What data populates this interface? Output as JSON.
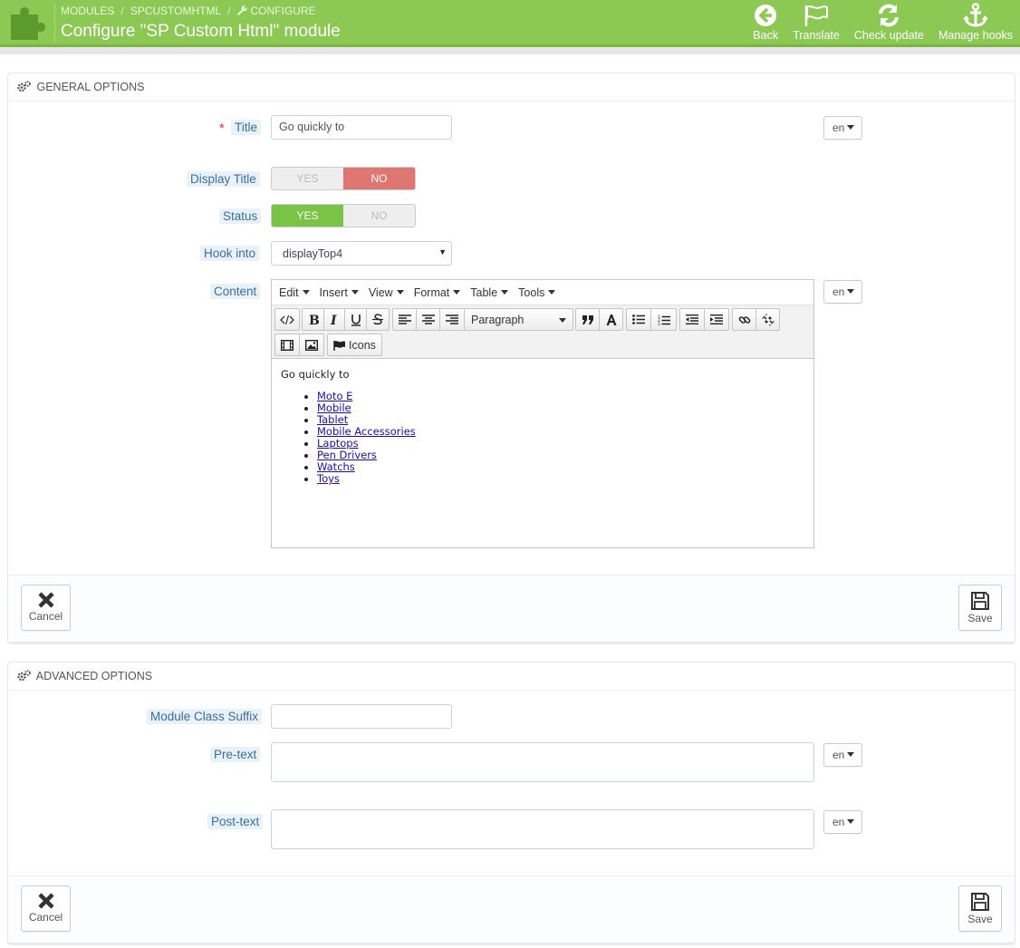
{
  "header": {
    "breadcrumb": [
      "MODULES",
      "SPCUSTOMHTML",
      "CONFIGURE"
    ],
    "breadcrumb_separator": "/",
    "title": "Configure \"SP Custom Html\" module",
    "toolbar": [
      {
        "label": "Back",
        "icon": "back-circle-arrow-icon"
      },
      {
        "label": "Translate",
        "icon": "flag-icon"
      },
      {
        "label": "Check update",
        "icon": "refresh-icon"
      },
      {
        "label": "Manage hooks",
        "icon": "anchor-icon"
      }
    ]
  },
  "general": {
    "heading": "GENERAL OPTIONS",
    "required_mark": "*",
    "title_label": "Title",
    "title_value": "Go quickly to",
    "lang": "en",
    "display_title_label": "Display Title",
    "display_title": {
      "yes": "YES",
      "no": "NO",
      "selected": "NO"
    },
    "status_label": "Status",
    "status": {
      "yes": "YES",
      "no": "NO",
      "selected": "YES"
    },
    "hook_label": "Hook into",
    "hook_value": "displayTop4",
    "content_label": "Content",
    "editor": {
      "menus": [
        "Edit",
        "Insert",
        "View",
        "Format",
        "Table",
        "Tools"
      ],
      "format_select": "Paragraph",
      "icons_button": "Icons",
      "body_paragraph": "Go quickly to",
      "links": [
        "Moto E",
        "Mobile",
        "Tablet",
        "Mobile Accessories",
        "Laptops",
        "Pen Drivers",
        "Watchs",
        "Toys"
      ]
    },
    "cancel": "Cancel",
    "save": "Save"
  },
  "advanced": {
    "heading": "ADVANCED OPTIONS",
    "suffix_label": "Module Class Suffix",
    "suffix_value": "",
    "pretext_label": "Pre-text",
    "posttext_label": "Post-text",
    "lang": "en",
    "cancel": "Cancel",
    "save": "Save"
  },
  "colors": {
    "header_green": "#8bc954",
    "switch_yes": "#79c447",
    "switch_no": "#e07672",
    "label_blue": "#3a6ea0"
  }
}
